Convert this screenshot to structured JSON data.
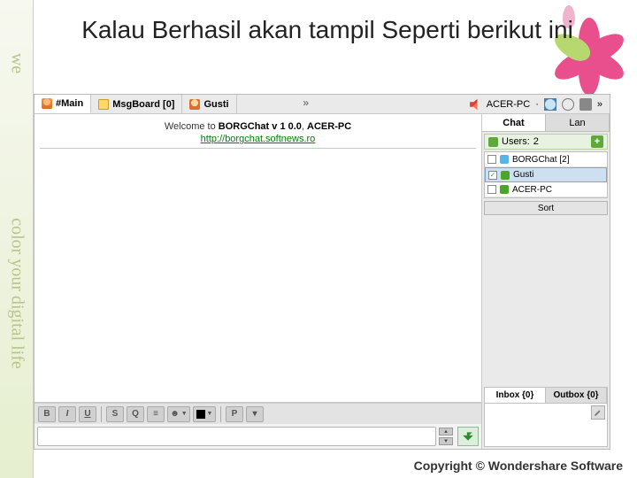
{
  "slide": {
    "title": "Kalau Berhasil akan tampil Seperti berikut ini",
    "vertical_text_1": "we",
    "vertical_text_2": "color your digital life"
  },
  "tabs": {
    "main": "#Main",
    "msgboard": "MsgBoard [0]",
    "user": "Gusti",
    "more": "»"
  },
  "topright": {
    "pc": "ACER-PC",
    "more": "»"
  },
  "welcome": {
    "prefix": "Welcome to ",
    "app": "BORGChat v 1 0.0",
    "sep": ", ",
    "pc": "ACER-PC",
    "url": "http://borgchat.softnews.ro"
  },
  "toolbar": {
    "bold": "B",
    "italic": "I",
    "underline": "U",
    "strike": "S",
    "quote": "Q",
    "list": "≡",
    "emoji": "☻",
    "paint": "P",
    "more": "▾"
  },
  "right": {
    "tab_chat": "Chat",
    "tab_lan": "Lan",
    "users_label": "Users:",
    "users_count": "2",
    "sort_label": "Sort",
    "list": [
      {
        "name": "BORGChat  [2]",
        "checked": false,
        "icon": "grp",
        "sel": false
      },
      {
        "name": "Gusti",
        "checked": true,
        "icon": "on",
        "sel": true
      },
      {
        "name": "ACER-PC",
        "checked": false,
        "icon": "on",
        "sel": false
      }
    ],
    "inbox": "Inbox {0}",
    "outbox": "Outbox {0}"
  },
  "copyright": "Copyright © Wondershare Software"
}
